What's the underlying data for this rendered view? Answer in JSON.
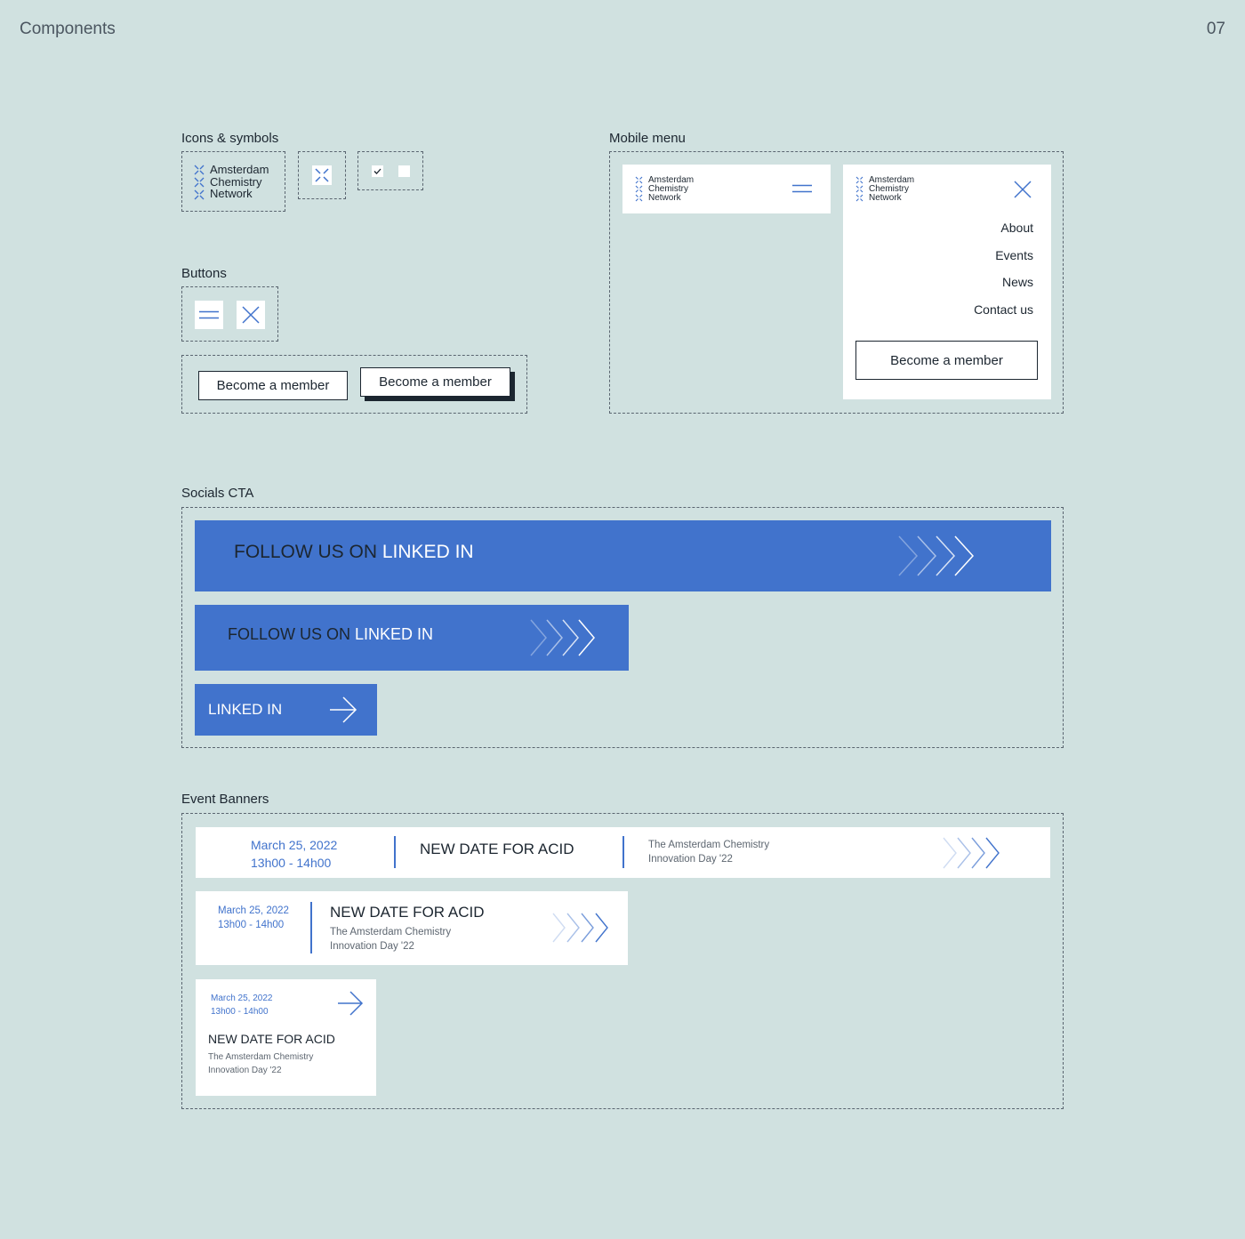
{
  "page": {
    "title": "Components",
    "number": "07"
  },
  "sections": {
    "icons": "Icons & symbols",
    "buttons": "Buttons",
    "mobile": "Mobile menu",
    "socials": "Socials CTA",
    "events": "Event Banners"
  },
  "logo": {
    "line1": "Amsterdam",
    "line2": "Chemistry",
    "line3": "Network"
  },
  "buttons": {
    "member_label": "Become a member"
  },
  "mobile_menu": {
    "items": [
      "About",
      "Events",
      "News",
      "Contact us"
    ],
    "cta_label": "Become a member"
  },
  "socials": {
    "prefix": "FOLLOW US ON",
    "highlight": "LINKED IN",
    "short_label": "LINKED IN"
  },
  "event": {
    "date": "March 25, 2022",
    "time": "13h00 - 14h00",
    "title": "NEW DATE FOR ACID",
    "subtitle_line1": "The Amsterdam Chemistry",
    "subtitle_line2": "Innovation Day '22"
  },
  "colors": {
    "background": "#d0e1e0",
    "accent_blue": "#4173cc",
    "ink": "#1c2630"
  },
  "icons": [
    "logo-mark-icon",
    "checkbox-checked-icon",
    "checkbox-empty-icon",
    "hamburger-icon",
    "close-icon",
    "chevrons-icon",
    "arrow-right-icon"
  ]
}
